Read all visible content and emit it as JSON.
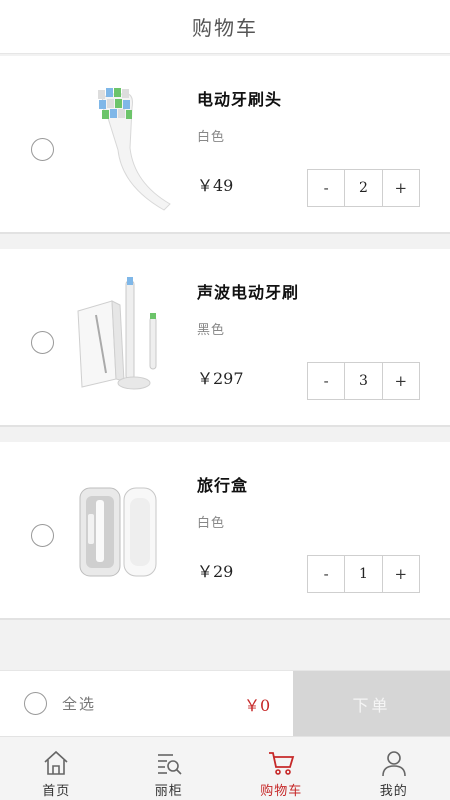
{
  "header": {
    "title": "购物车"
  },
  "items": [
    {
      "name": "电动牙刷头",
      "variant": "白色",
      "price": "￥49",
      "qty": "2",
      "minus": "-",
      "plus": "+",
      "image": "toothbrush-head"
    },
    {
      "name": "声波电动牙刷",
      "variant": "黑色",
      "price": "￥297",
      "qty": "3",
      "minus": "-",
      "plus": "+",
      "image": "sonic-toothbrush-set"
    },
    {
      "name": "旅行盒",
      "variant": "白色",
      "price": "￥29",
      "qty": "1",
      "minus": "-",
      "plus": "+",
      "image": "travel-case"
    }
  ],
  "checkout": {
    "select_all": "全选",
    "total": "￥0",
    "order": "下单"
  },
  "tabbar": {
    "tabs": [
      {
        "label": "首页",
        "icon": "home-icon"
      },
      {
        "label": "丽柜",
        "icon": "search-list-icon"
      },
      {
        "label": "购物车",
        "icon": "cart-icon"
      },
      {
        "label": "我的",
        "icon": "user-icon"
      }
    ],
    "active_index": 2
  },
  "colors": {
    "accent": "#c62828",
    "order_button_disabled": "#d6d6d6"
  }
}
